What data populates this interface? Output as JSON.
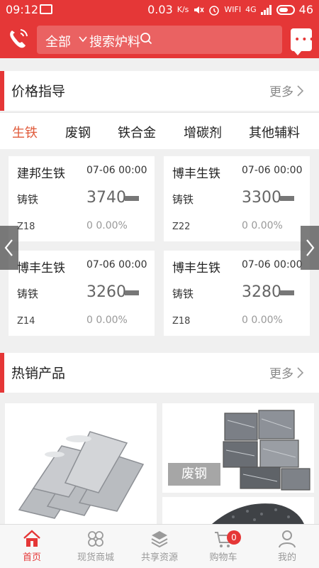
{
  "status_bar": {
    "time": "09:12",
    "speed": "0.03",
    "speed_unit": "K/s",
    "wifi": "WIFI",
    "network": "4G",
    "battery": "46"
  },
  "header": {
    "search_scope": "全部",
    "search_placeholder": "搜索炉料"
  },
  "price_section": {
    "title": "价格指导",
    "more": "更多"
  },
  "tabs": [
    {
      "label": "生铁"
    },
    {
      "label": "废钢"
    },
    {
      "label": "铁合金"
    },
    {
      "label": "增碳剂"
    },
    {
      "label": "其他辅料"
    }
  ],
  "price_cards": [
    {
      "name": "建邦生铁",
      "date": "07-06 00:00",
      "type": "铸铁",
      "price": "3740",
      "grade": "Z18",
      "change": "0 0.00%"
    },
    {
      "name": "博丰生铁",
      "date": "07-06 00:00",
      "type": "铸铁",
      "price": "3300",
      "grade": "Z22",
      "change": "0 0.00%"
    },
    {
      "name": "博丰生铁",
      "date": "07-06 00:00",
      "type": "铸铁",
      "price": "3260",
      "grade": "Z14",
      "change": "0 0.00%"
    },
    {
      "name": "博丰生铁",
      "date": "07-06 00:00",
      "type": "铸铁",
      "price": "3280",
      "grade": "Z18",
      "change": "0 0.00%"
    }
  ],
  "hot_section": {
    "title": "热销产品",
    "more": "更多"
  },
  "products": [
    {
      "tag": ""
    },
    {
      "tag": "废钢"
    }
  ],
  "bottom_nav": [
    {
      "label": "首页",
      "icon": "home-icon"
    },
    {
      "label": "现货商城",
      "icon": "clover-icon"
    },
    {
      "label": "共享资源",
      "icon": "layers-icon"
    },
    {
      "label": "购物车",
      "icon": "cart-icon",
      "badge": "0"
    },
    {
      "label": "我的",
      "icon": "person-icon"
    }
  ],
  "colors": {
    "brand": "#e53737",
    "active_tab": "#e05a3a"
  }
}
